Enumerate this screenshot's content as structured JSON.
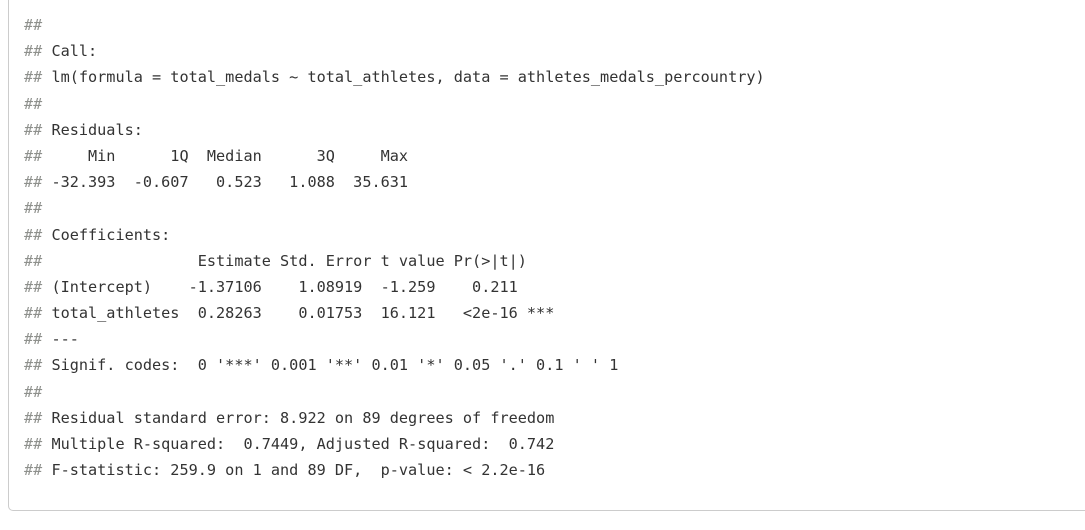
{
  "output": {
    "prefix": "##",
    "lines": [
      "",
      " Call:",
      " lm(formula = total_medals ~ total_athletes, data = athletes_medals_percountry)",
      "",
      " Residuals:",
      "     Min      1Q  Median      3Q     Max ",
      " -32.393  -0.607   0.523   1.088  35.631 ",
      "",
      " Coefficients:",
      "                 Estimate Std. Error t value Pr(>|t|)    ",
      " (Intercept)    -1.37106    1.08919  -1.259    0.211    ",
      " total_athletes  0.28263    0.01753  16.121   <2e-16 ***",
      " ---",
      " Signif. codes:  0 '***' 0.001 '**' 0.01 '*' 0.05 '.' 0.1 ' ' 1",
      "",
      " Residual standard error: 8.922 on 89 degrees of freedom",
      " Multiple R-squared:  0.7449,\tAdjusted R-squared:  0.742 ",
      " F-statistic: 259.9 on 1 and 89 DF,  p-value: < 2.2e-16"
    ]
  }
}
